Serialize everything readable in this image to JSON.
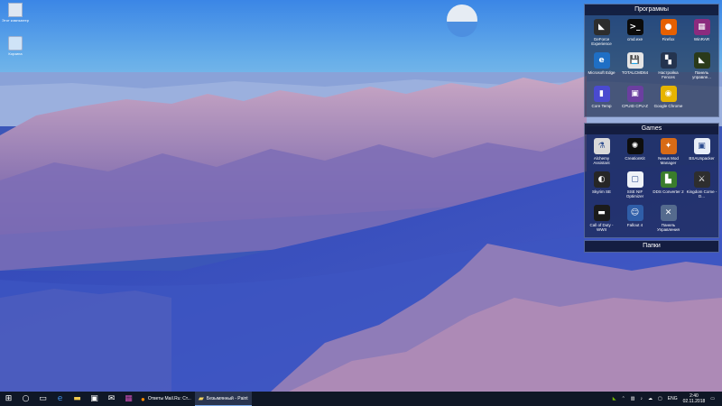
{
  "desktop": {
    "icons": [
      {
        "label": "Этот компьютер"
      },
      {
        "label": "Корзина"
      }
    ]
  },
  "fences": {
    "programs": {
      "title": "Программы",
      "items": [
        {
          "label": "GeForce Experience",
          "icon": "nvidia-icon",
          "color": "#2d2d2d",
          "glyph": "◣"
        },
        {
          "label": "cmd.exe",
          "icon": "cmd-icon",
          "color": "#0b0b0b",
          "glyph": ">_"
        },
        {
          "label": "Firefox",
          "icon": "firefox-icon",
          "color": "#e66000",
          "glyph": "●"
        },
        {
          "label": "WinRAR",
          "icon": "winrar-icon",
          "color": "#8c2b7e",
          "glyph": "▦"
        },
        {
          "label": "Microsoft Edge",
          "icon": "edge-icon",
          "color": "#1f6fc5",
          "glyph": "e"
        },
        {
          "label": "TOTALCMD64",
          "icon": "totalcmd-icon",
          "color": "#e5e5e5",
          "glyph": "💾"
        },
        {
          "label": "Настройка Fences",
          "icon": "fences-icon",
          "color": "#24344f",
          "glyph": "▚"
        },
        {
          "label": "Панель управле...",
          "icon": "nvidia-panel-icon",
          "color": "#2a3a1a",
          "glyph": "◣"
        },
        {
          "label": "Core Temp",
          "icon": "coretemp-icon",
          "color": "#4a4ad0",
          "glyph": "▮"
        },
        {
          "label": "CPUID CPU-Z",
          "icon": "cpuz-icon",
          "color": "#6b3fa0",
          "glyph": "▣"
        },
        {
          "label": "Google Chrome",
          "icon": "chrome-icon",
          "color": "#e6b400",
          "glyph": "◉"
        }
      ]
    },
    "games": {
      "title": "Games",
      "items": [
        {
          "label": "Alchemy Assistant",
          "icon": "alchemy-icon",
          "color": "#d9d9d9",
          "glyph": "⚗"
        },
        {
          "label": "CreationKit",
          "icon": "creationkit-icon",
          "color": "#0e0e0e",
          "glyph": "✺"
        },
        {
          "label": "Nexus Mod Manager",
          "icon": "nexus-icon",
          "color": "#d86b16",
          "glyph": "✦"
        },
        {
          "label": "BSAUnpacker",
          "icon": "bsa-icon",
          "color": "#e8eef8",
          "glyph": "▣"
        },
        {
          "label": "Skyrim SE",
          "icon": "skyrim-icon",
          "color": "#262626",
          "glyph": "◐"
        },
        {
          "label": "SSE NIF Optimizer",
          "icon": "nif-icon",
          "color": "#eef2f8",
          "glyph": "▢"
        },
        {
          "label": "DDS Converter 2",
          "icon": "dds-icon",
          "color": "#3a7d2c",
          "glyph": "▙"
        },
        {
          "label": "Kingdom Come - D...",
          "icon": "kingdom-icon",
          "color": "#2e2e2e",
          "glyph": "⚔"
        },
        {
          "label": "Call of Duty - WWII",
          "icon": "cod-icon",
          "color": "#1b1b1b",
          "glyph": "▬"
        },
        {
          "label": "Fallout 4",
          "icon": "fallout-icon",
          "color": "#2f5ea8",
          "glyph": "☺"
        },
        {
          "label": "Панель Управления",
          "icon": "control-panel-icon",
          "color": "#556b8e",
          "glyph": "✕"
        }
      ]
    },
    "folders": {
      "title": "Папки"
    }
  },
  "taskbar": {
    "tasks": [
      {
        "label": "Ответы Mail.Ru: Ст...",
        "icon": "firefox-icon"
      },
      {
        "label": "Безымянный - Paint",
        "icon": "paint-icon"
      }
    ],
    "tray": {
      "lang": "ENG",
      "time": "2:40",
      "date": "02.11.2018"
    }
  }
}
